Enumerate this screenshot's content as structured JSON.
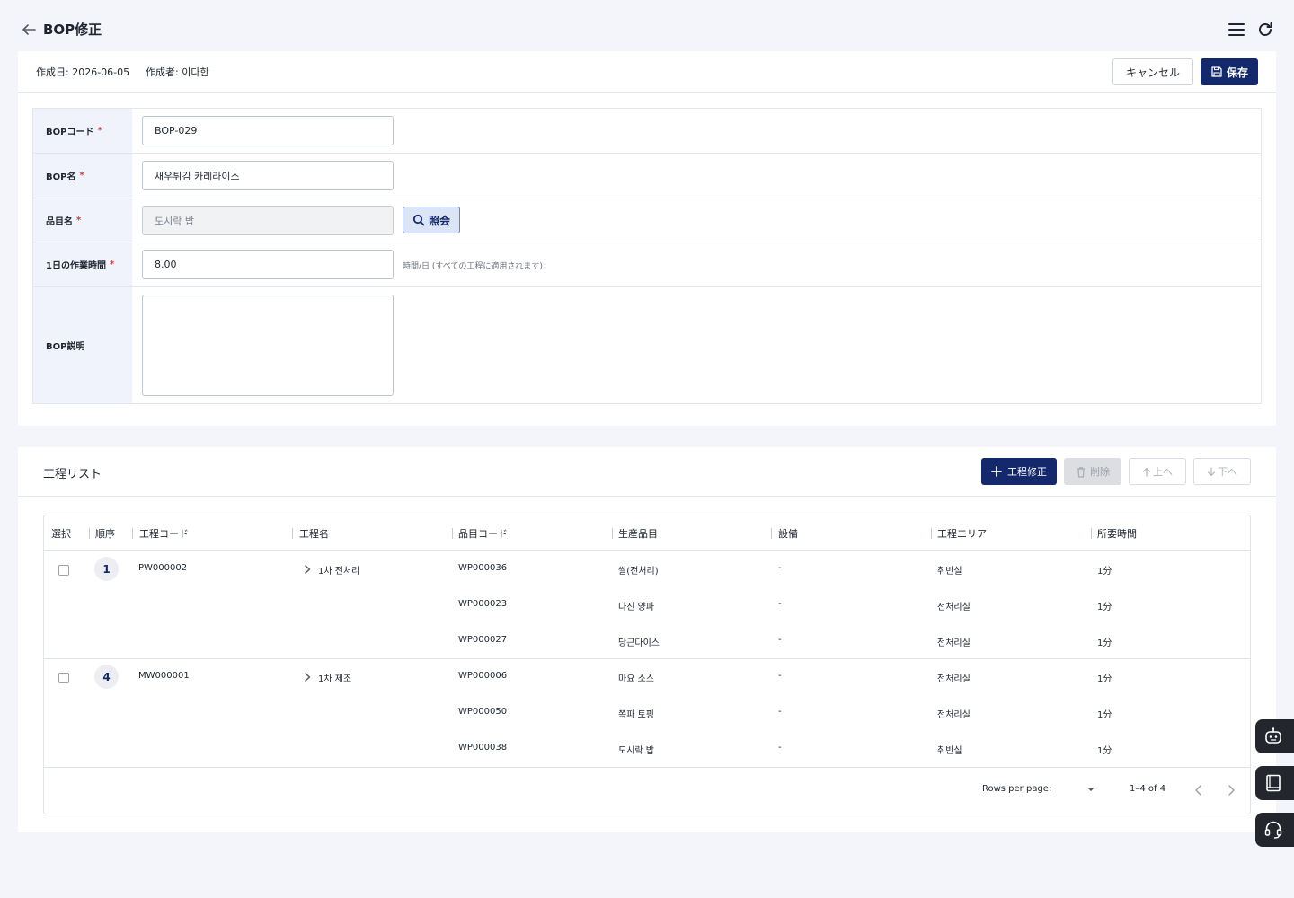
{
  "header": {
    "title": "BOP修正",
    "back_icon": "arrow-left-icon",
    "menu_icon": "hamburger-menu-icon",
    "refresh_icon": "refresh-icon"
  },
  "meta": {
    "created_date": "作成日: 2026-06-05",
    "author": "作成者: 이다한"
  },
  "actions": {
    "cancel_label": "キャンセル",
    "save_label": "保存"
  },
  "form": {
    "code_label": "BOPコード",
    "code_value": "BOP-029",
    "name_label": "BOP名",
    "name_value": "새우튀김 카레라이스",
    "item_label": "品目名",
    "item_value": "도시락 밥",
    "lookup_label": "照会",
    "hours_label": "1日の作業時間",
    "hours_value": "8.00",
    "hours_hint": "時間/日 (すべての工程に適用されます)",
    "desc_label": "BOP説明",
    "required_mark": "*"
  },
  "process_list": {
    "title": "工程リスト",
    "edit_label": "工程修正",
    "delete_label": "削除",
    "up_label": "上へ",
    "down_label": "下へ",
    "columns": [
      "選択",
      "順序",
      "工程コード",
      "工程名",
      "品目コード",
      "生産品目",
      "設備",
      "工程エリア",
      "所要時間"
    ],
    "groups": [
      {
        "order": "1",
        "process_code": "PW000002",
        "process_name": "1차 전처리",
        "items": [
          {
            "item_code": "WP000036",
            "product": "쌀(전처리)",
            "equipment": "-",
            "area": "취반실",
            "time": "1分"
          },
          {
            "item_code": "WP000023",
            "product": "다진 양파",
            "equipment": "-",
            "area": "전처리실",
            "time": "1分"
          },
          {
            "item_code": "WP000027",
            "product": "당근다이스",
            "equipment": "-",
            "area": "전처리실",
            "time": "1分"
          }
        ]
      },
      {
        "order": "4",
        "process_code": "MW000001",
        "process_name": "1차 제조",
        "items": [
          {
            "item_code": "WP000006",
            "product": "마요 소스",
            "equipment": "-",
            "area": "전처리실",
            "time": "1分"
          },
          {
            "item_code": "WP000050",
            "product": "쪽파 토핑",
            "equipment": "-",
            "area": "전처리실",
            "time": "1分"
          },
          {
            "item_code": "WP000038",
            "product": "도시락 밥",
            "equipment": "-",
            "area": "취반실",
            "time": "1分"
          }
        ]
      }
    ],
    "footer": {
      "rows_per_page_label": "Rows per page:",
      "range": "1–4 of 4"
    }
  },
  "side_buttons": [
    "chatbot-icon",
    "manual-book-icon",
    "headset-support-icon"
  ],
  "colors": {
    "primary": "#14296b",
    "background": "#f3f5fa",
    "label_bg": "#f0f3fb",
    "required": "#d23a3a",
    "side_button": "#23262d"
  }
}
